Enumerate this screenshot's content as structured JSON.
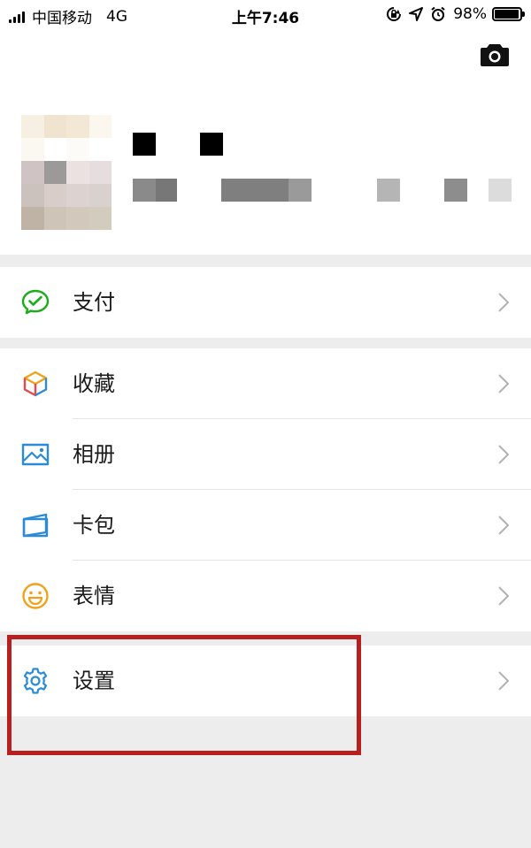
{
  "status_bar": {
    "carrier": "中国移动",
    "network": "4G",
    "time": "上午7:46",
    "battery_percent": "98%",
    "battery_level": 0.98
  },
  "profile": {
    "camera_icon": "camera-icon"
  },
  "menu": {
    "pay": {
      "label": "支付",
      "icon": "wechat-pay-icon",
      "color": "#1aad19"
    },
    "favorites": {
      "label": "收藏",
      "icon": "favorites-cube-icon"
    },
    "album": {
      "label": "相册",
      "icon": "album-picture-icon",
      "color": "#2b8bd6"
    },
    "cards": {
      "label": "卡包",
      "icon": "card-wallet-icon",
      "color": "#2b8bd6"
    },
    "stickers": {
      "label": "表情",
      "icon": "smiley-icon",
      "color": "#f0a11a"
    },
    "settings": {
      "label": "设置",
      "icon": "gear-icon",
      "color": "#2b8bd6"
    }
  },
  "highlight_color": "#b7201e"
}
